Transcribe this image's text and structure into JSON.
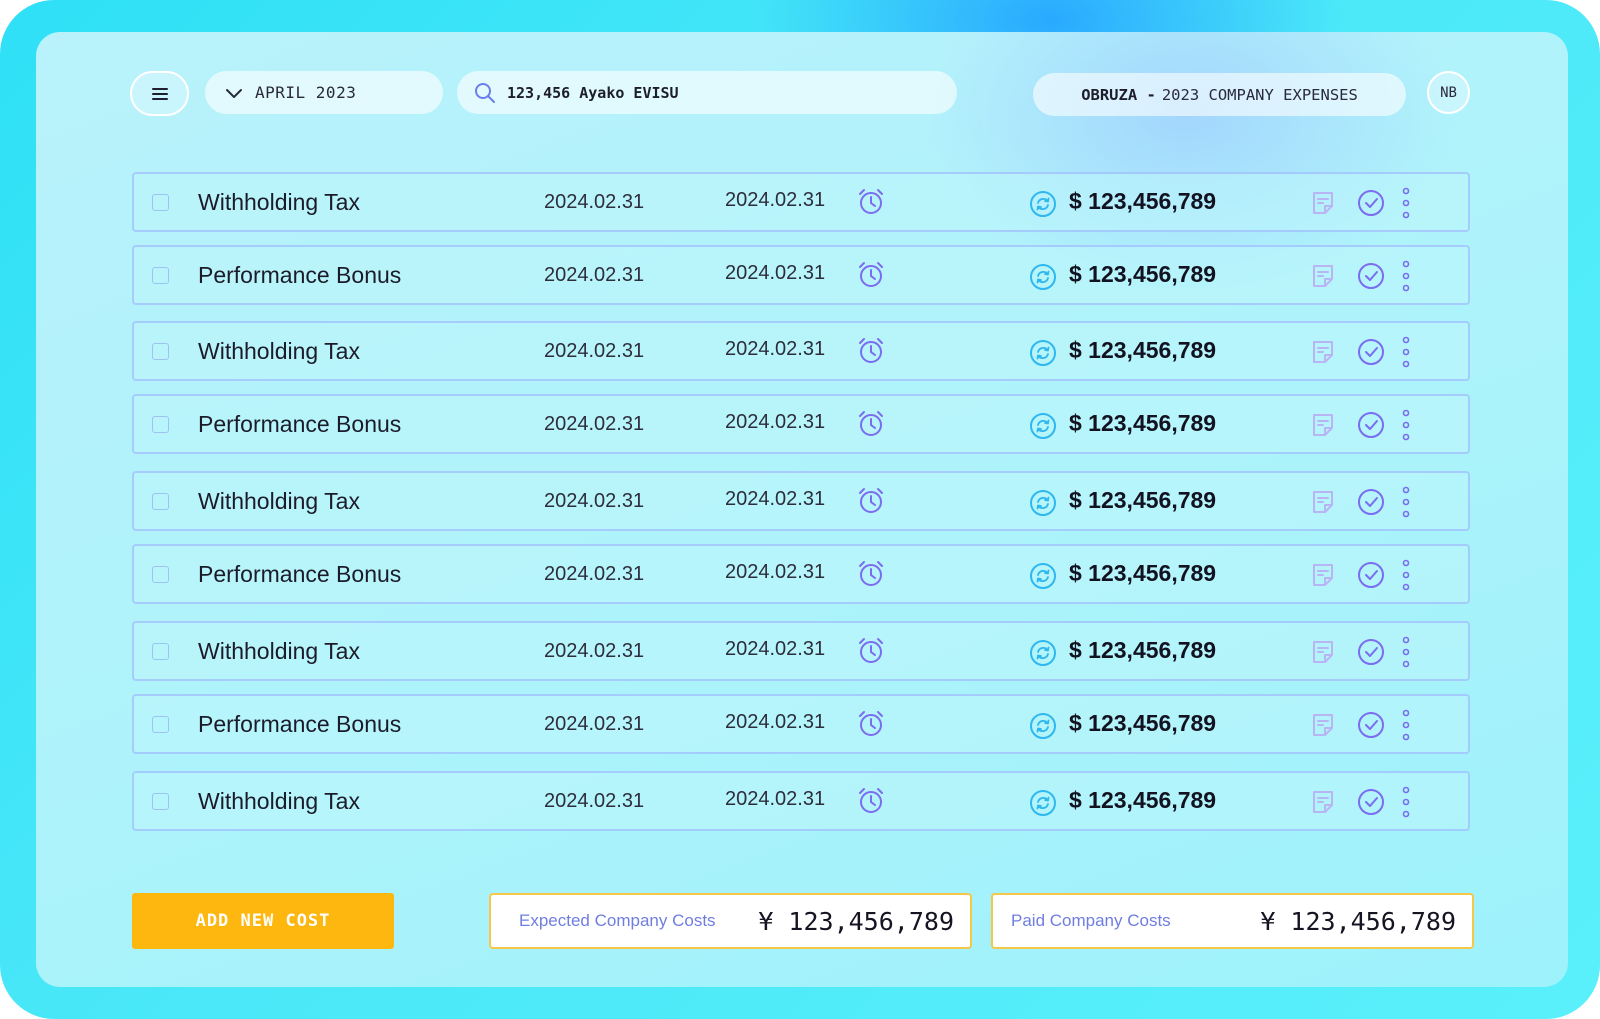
{
  "header": {
    "month": "APRIL 2023",
    "search_value": "123,456 Ayako EVISU",
    "brand": "OBRUZA -",
    "title": "2023 COMPANY EXPENSES",
    "avatar_initials": "NB"
  },
  "rows": [
    {
      "name": "Withholding Tax",
      "date1": "2024.02.31",
      "date2": "2024.02.31",
      "amount": "$ 123,456,789"
    },
    {
      "name": "Performance Bonus",
      "date1": "2024.02.31",
      "date2": "2024.02.31",
      "amount": "$ 123,456,789"
    },
    {
      "name": "Withholding Tax",
      "date1": "2024.02.31",
      "date2": "2024.02.31",
      "amount": "$ 123,456,789"
    },
    {
      "name": "Performance Bonus",
      "date1": "2024.02.31",
      "date2": "2024.02.31",
      "amount": "$ 123,456,789"
    },
    {
      "name": "Withholding Tax",
      "date1": "2024.02.31",
      "date2": "2024.02.31",
      "amount": "$ 123,456,789"
    },
    {
      "name": "Performance Bonus",
      "date1": "2024.02.31",
      "date2": "2024.02.31",
      "amount": "$ 123,456,789"
    },
    {
      "name": "Withholding Tax",
      "date1": "2024.02.31",
      "date2": "2024.02.31",
      "amount": "$ 123,456,789"
    },
    {
      "name": "Performance Bonus",
      "date1": "2024.02.31",
      "date2": "2024.02.31",
      "amount": "$ 123,456,789"
    },
    {
      "name": "Withholding Tax",
      "date1": "2024.02.31",
      "date2": "2024.02.31",
      "amount": "$ 123,456,789"
    }
  ],
  "footer": {
    "add_label": "ADD NEW COST",
    "expected_label": "Expected Company Costs",
    "expected_value": "¥ 123,456,789",
    "paid_label": "Paid Company Costs",
    "paid_value": "¥ 123,456,789"
  },
  "icons": {
    "menu": "hamburger-menu-icon",
    "dropdown": "chevron-down-icon",
    "search": "search-icon",
    "alarm": "alarm-clock-icon",
    "sync": "sync-icon",
    "note": "note-icon",
    "check": "check-circle-icon",
    "more": "more-vertical-icon"
  },
  "colors": {
    "accent_purple": "#7b6cf0",
    "sync_blue": "#2fb7f0",
    "button_yellow": "#fdb70e",
    "cost_label": "#6f7ee0"
  }
}
